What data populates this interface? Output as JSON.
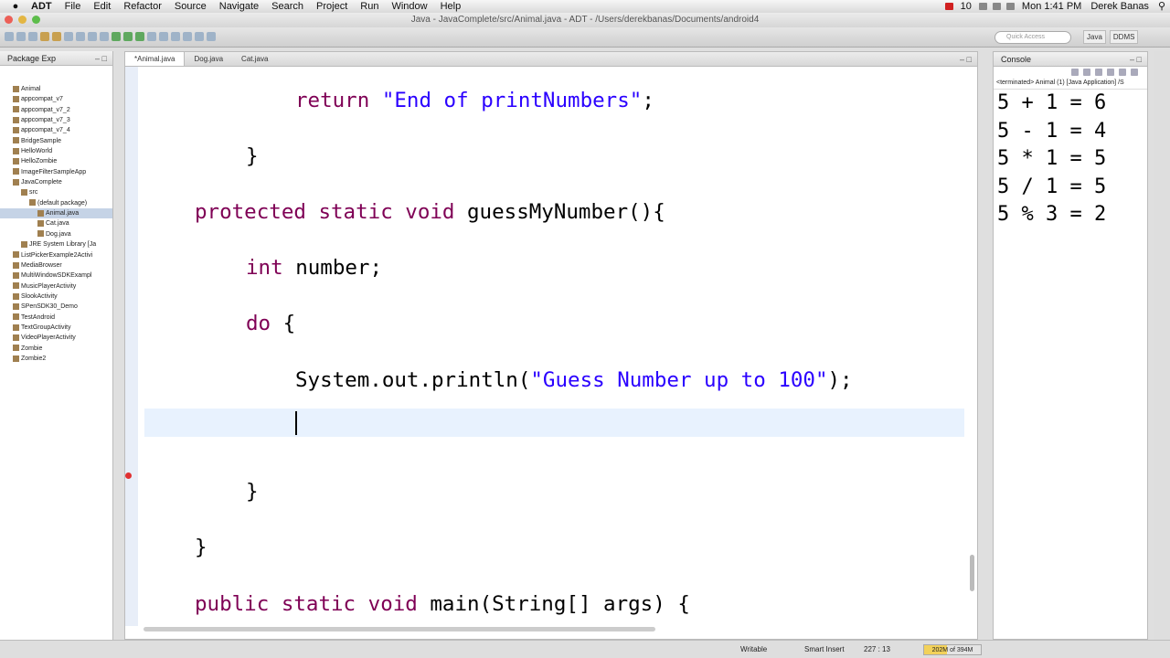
{
  "menubar": {
    "app": "ADT",
    "items": [
      "File",
      "Edit",
      "Refactor",
      "Source",
      "Navigate",
      "Search",
      "Project",
      "Run",
      "Window",
      "Help"
    ],
    "tray_number": "10",
    "clock": "Mon 1:41 PM",
    "user": "Derek Banas"
  },
  "window": {
    "title": "Java - JavaComplete/src/Animal.java - ADT - /Users/derekbanas/Documents/android4"
  },
  "toolbar": {
    "quick_access": "Quick Access",
    "perspectives": [
      "Java",
      "DDMS"
    ]
  },
  "package_explorer": {
    "title": "Package Exp",
    "items": [
      {
        "label": "Animal",
        "level": 0
      },
      {
        "label": "appcompat_v7",
        "level": 0
      },
      {
        "label": "appcompat_v7_2",
        "level": 0
      },
      {
        "label": "appcompat_v7_3",
        "level": 0
      },
      {
        "label": "appcompat_v7_4",
        "level": 0
      },
      {
        "label": "BridgeSample",
        "level": 0
      },
      {
        "label": "HelloWorld",
        "level": 0
      },
      {
        "label": "HelloZombie",
        "level": 0
      },
      {
        "label": "ImageFilterSampleApp",
        "level": 0
      },
      {
        "label": "JavaComplete",
        "level": 0
      },
      {
        "label": "src",
        "level": 1
      },
      {
        "label": "(default package)",
        "level": 2
      },
      {
        "label": "Animal.java",
        "level": 3,
        "selected": true
      },
      {
        "label": "Cat.java",
        "level": 3
      },
      {
        "label": "Dog.java",
        "level": 3
      },
      {
        "label": "JRE System Library [Ja",
        "level": 1
      },
      {
        "label": "ListPickerExample2Activi",
        "level": 0
      },
      {
        "label": "MediaBrowser",
        "level": 0
      },
      {
        "label": "MultiWindowSDKExampl",
        "level": 0
      },
      {
        "label": "MusicPlayerActivity",
        "level": 0
      },
      {
        "label": "SlookActivity",
        "level": 0
      },
      {
        "label": "SPenSDK30_Demo",
        "level": 0
      },
      {
        "label": "TestAndroid",
        "level": 0
      },
      {
        "label": "TextGroupActivity",
        "level": 0
      },
      {
        "label": "VideoPlayerActivity",
        "level": 0
      },
      {
        "label": "Zombie",
        "level": 0
      },
      {
        "label": "Zombie2",
        "level": 0
      }
    ]
  },
  "editor": {
    "tabs": [
      "*Animal.java",
      "Dog.java",
      "Cat.java"
    ],
    "lines": [
      {
        "indent": 2,
        "parts": [
          [
            "kw",
            "return "
          ],
          [
            "str",
            "\"End of printNumbers\""
          ],
          [
            "",
            "; "
          ]
        ]
      },
      {
        "indent": 1,
        "parts": [
          [
            "",
            "}"
          ]
        ]
      },
      {
        "indent": 0,
        "parts": [
          [
            "kw",
            "protected static void "
          ],
          [
            "",
            "guessMyNumber(){"
          ]
        ]
      },
      {
        "indent": 1,
        "parts": [
          [
            "kw",
            "int "
          ],
          [
            "",
            "number;"
          ]
        ]
      },
      {
        "indent": 1,
        "parts": [
          [
            "kw",
            "do "
          ],
          [
            "",
            "{"
          ]
        ]
      },
      {
        "indent": 2,
        "parts": [
          [
            "",
            "System.out.println("
          ],
          [
            "str",
            "\"Guess Number up to 100\""
          ],
          [
            "",
            ");"
          ]
        ]
      },
      {
        "indent": 2,
        "parts": [
          [
            "",
            ""
          ]
        ]
      },
      {
        "indent": 1,
        "parts": [
          [
            "",
            "}"
          ]
        ]
      },
      {
        "indent": 0,
        "parts": [
          [
            "",
            "}"
          ]
        ]
      },
      {
        "indent": 0,
        "parts": [
          [
            "kw",
            "public static void "
          ],
          [
            "",
            "main(String[] args) {"
          ]
        ]
      }
    ]
  },
  "console": {
    "title": "Console",
    "status": "<terminated> Animal (1) [Java Application] /S",
    "output": [
      "5 + 1 = 6",
      "5 - 1 = 4",
      "5 * 1 = 5",
      "5 / 1 = 5",
      "5 % 3 = 2"
    ]
  },
  "status": {
    "writable": "Writable",
    "insert": "Smart Insert",
    "position": "227 : 13",
    "heap": "202M of 394M"
  }
}
